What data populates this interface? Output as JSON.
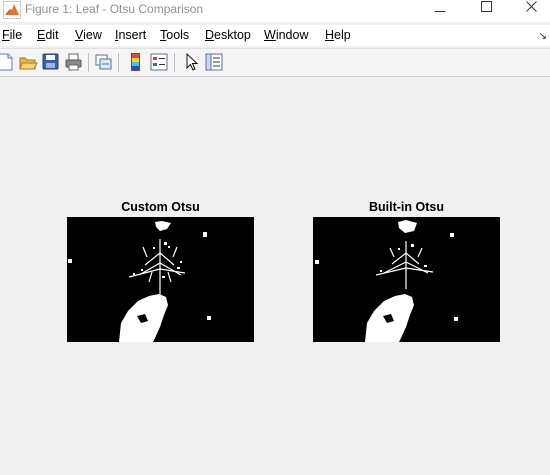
{
  "window": {
    "title": "Figure 1: Leaf - Otsu Comparison",
    "icon": "matlab-icon",
    "controls": [
      "minimize-icon",
      "maximize-icon",
      "close-icon"
    ]
  },
  "menu": {
    "file": {
      "mnemonic": "F",
      "rest": "ile"
    },
    "edit": {
      "mnemonic": "E",
      "rest": "dit"
    },
    "view": {
      "mnemonic": "V",
      "rest": "iew"
    },
    "insert": {
      "mnemonic": "I",
      "rest": "nsert"
    },
    "tools": {
      "mnemonic": "T",
      "rest": "ools"
    },
    "desktop": {
      "mnemonic": "D",
      "rest": "esktop"
    },
    "window": {
      "mnemonic": "W",
      "rest": "indow"
    },
    "help": {
      "mnemonic": "H",
      "rest": "elp"
    },
    "dock_arrow": "↘"
  },
  "toolbar": {
    "buttons": [
      "new-figure-icon",
      "open-file-icon",
      "save-icon",
      "print-icon",
      "link-plot-icon",
      "insert-colorbar-icon",
      "insert-legend-icon",
      "edit-plot-icon",
      "property-inspector-icon"
    ]
  },
  "figure": {
    "left_title": "Custom Otsu",
    "right_title": "Built-in Otsu",
    "colors": {
      "background": "#000000",
      "foreground": "#ffffff"
    }
  }
}
